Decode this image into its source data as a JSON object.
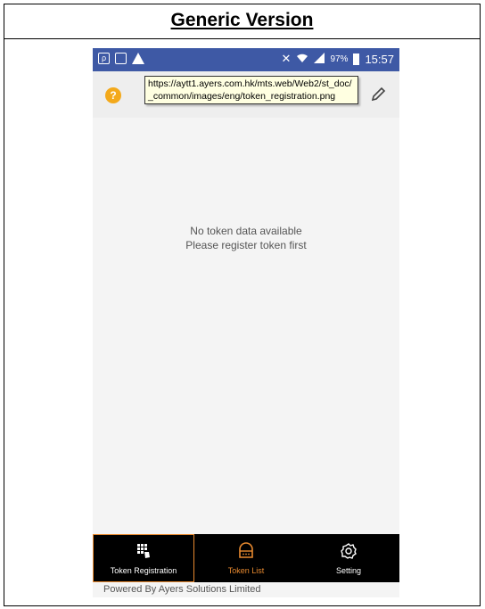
{
  "doc": {
    "title": "Generic Version"
  },
  "statusbar": {
    "battery_pct": "97%",
    "time": "15:57"
  },
  "toolbar": {
    "tooltip_url": "https://aytt1.ayers.com.hk/mts.web/Web2/st_doc/_common/images/eng/token_registration.png"
  },
  "main": {
    "empty_line1": "No token data available",
    "empty_line2": "Please register token first"
  },
  "nav": {
    "items": [
      {
        "label": "Token Registration",
        "icon": "token-registration-icon",
        "state": "selected"
      },
      {
        "label": "Token List",
        "icon": "token-list-icon",
        "state": "highlighted"
      },
      {
        "label": "Setting",
        "icon": "gear-icon",
        "state": "normal"
      }
    ]
  },
  "footer": {
    "powered": "Powered By Ayers Solutions Limited"
  },
  "colors": {
    "statusbar": "#3e59a5",
    "accent": "#e7892f",
    "help": "#f3a91b"
  }
}
